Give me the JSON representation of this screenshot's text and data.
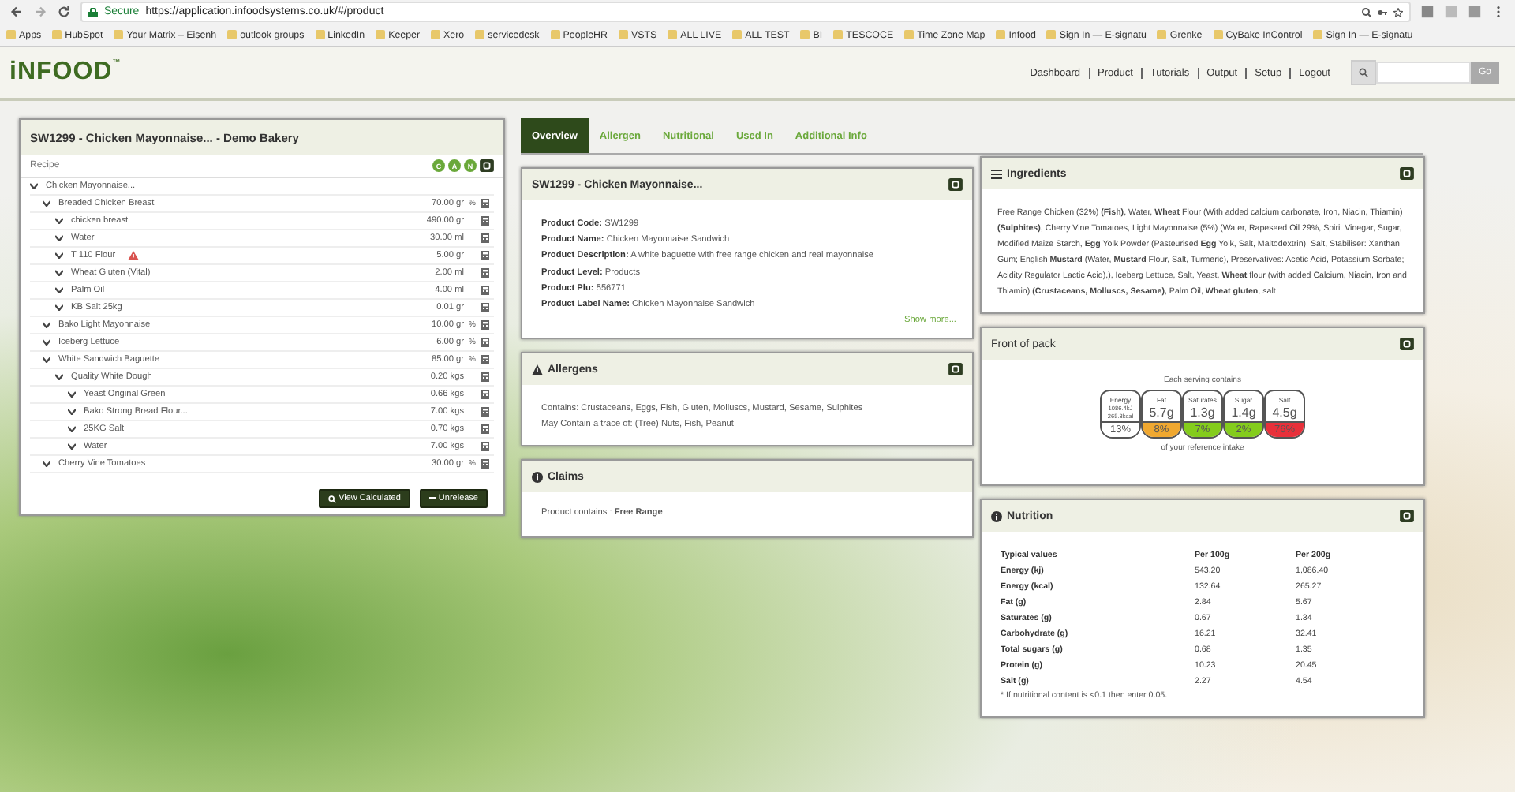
{
  "browser": {
    "secure_label": "Secure",
    "url": "https://application.infoodsystems.co.uk/#/product",
    "bookmarks": [
      "Apps",
      "HubSpot",
      "Your Matrix – Eisenh",
      "outlook groups",
      "LinkedIn",
      "Keeper",
      "Xero",
      "servicedesk",
      "PeopleHR",
      "VSTS",
      "ALL LIVE",
      "ALL TEST",
      "BI",
      "TESCOCE",
      "Time Zone Map",
      "Infood",
      "Sign In — E-signatu",
      "Grenke",
      "CyBake InControl",
      "Sign In — E-signatu"
    ]
  },
  "header": {
    "logo": "iNFOOD",
    "logo_mark": "™",
    "nav": [
      "Dashboard",
      "Product",
      "Tutorials",
      "Output",
      "Setup",
      "Logout"
    ],
    "search_button": "Go"
  },
  "recipe_panel": {
    "title": "SW1299  - Chicken Mayonnaise...  - Demo Bakery",
    "section": "Recipe",
    "badges": [
      "C",
      "A",
      "N"
    ],
    "tree": [
      {
        "name": "Chicken Mayonnaise...",
        "children": [
          {
            "name": "Breaded Chicken Breast",
            "amount": "70.00 gr",
            "percent": "%",
            "warning": false,
            "children": [
              {
                "name": "chicken breast",
                "amount": "490.00 gr",
                "warning": false
              },
              {
                "name": "Water",
                "amount": "30.00 ml",
                "warning": false
              },
              {
                "name": "T 110 Flour",
                "amount": "5.00 gr",
                "warning": true
              },
              {
                "name": "Wheat Gluten (Vital)",
                "amount": "2.00 ml",
                "warning": false
              },
              {
                "name": "Palm Oil",
                "amount": "4.00 ml",
                "warning": false
              },
              {
                "name": "KB Salt 25kg",
                "amount": "0.01 gr",
                "warning": false
              }
            ]
          },
          {
            "name": "Bako Light Mayonnaise",
            "amount": "10.00 gr",
            "percent": "%",
            "warning": false
          },
          {
            "name": "Iceberg Lettuce",
            "amount": "6.00 gr",
            "percent": "%",
            "warning": false
          },
          {
            "name": "White Sandwich Baguette",
            "amount": "85.00 gr",
            "percent": "%",
            "warning": false,
            "children": [
              {
                "name": "Quality White Dough",
                "amount": "0.20 kgs",
                "warning": false,
                "children": [
                  {
                    "name": "Yeast Original Green",
                    "amount": "0.66 kgs",
                    "warning": false
                  },
                  {
                    "name": "Bako Strong Bread Flour...",
                    "amount": "7.00 kgs",
                    "warning": false
                  },
                  {
                    "name": "25KG Salt",
                    "amount": "0.70 kgs",
                    "warning": false
                  },
                  {
                    "name": "Water",
                    "amount": "7.00 kgs",
                    "warning": false
                  }
                ]
              }
            ]
          },
          {
            "name": "Cherry Vine Tomatoes",
            "amount": "30.00 gr",
            "percent": "%",
            "warning": false
          }
        ]
      }
    ],
    "buttons": [
      "View Calculated",
      "Unrelease"
    ]
  },
  "tabs": [
    {
      "label": "Overview",
      "selected": true
    },
    {
      "label": "Allergen",
      "selected": false
    },
    {
      "label": "Nutritional",
      "selected": false
    },
    {
      "label": "Used In",
      "selected": false
    },
    {
      "label": "Additional Info",
      "selected": false
    }
  ],
  "product_card": {
    "title": "SW1299 - Chicken Mayonnaise...",
    "fields": [
      {
        "label": "Product Code:",
        "value": "SW1299"
      },
      {
        "label": "Product Name:",
        "value": "Chicken Mayonnaise Sandwich"
      },
      {
        "label": "Product Description:",
        "value": "A white baguette with free range chicken and real mayonnaise"
      },
      {
        "label": "Product Level:",
        "value": "Products"
      },
      {
        "label": "Product Plu:",
        "value": "556771"
      },
      {
        "label": "Product Label Name:",
        "value": "Chicken Mayonnaise Sandwich"
      }
    ],
    "link": "Show more..."
  },
  "allergens_card": {
    "title": "Allergens",
    "lines": [
      "Contains: Crustaceans, Eggs, Fish, Gluten, Molluscs, Mustard, Sesame, Sulphites",
      "May Contain a trace of: (Tree) Nuts, Fish, Peanut"
    ]
  },
  "claims_card": {
    "title": "Claims",
    "text": "Product contains : **Free Range**"
  },
  "ingredients_card": {
    "title": "Ingredients",
    "text": "Free Range Chicken (32%) **(Fish)**, Water, **Wheat** Flour (With added calcium carbonate, Iron, Niacin, Thiamin) **(Sulphites)**, Cherry Vine Tomatoes, Light Mayonnaise (5%) (Water, Rapeseed Oil 29%, Spirit Vinegar, Sugar, Modified Maize Starch, **Egg** Yolk Powder (Pasteurised **Egg** Yolk, Salt, Maltodextrin), Salt, Stabiliser: Xanthan Gum; English **Mustard** (Water, **Mustard** Flour, Salt, Turmeric), Preservatives: Acetic Acid, Potassium Sorbate; Acidity Regulator Lactic Acid),), Iceberg Lettuce, Salt, Yeast, **Wheat** flour (with added Calcium, Niacin, Iron and Thiamin) **(Crustaceans, Molluscs, Sesame)**, Palm Oil, **Wheat gluten**, salt"
  },
  "front_of_pack": {
    "title": "Front of pack",
    "heading": "Each serving contains",
    "footer": "of your reference intake",
    "items": [
      {
        "label": "Energy",
        "values": [
          "1086.4kJ",
          "265.3kcal"
        ],
        "percent": "13%",
        "color": "#ffffff"
      },
      {
        "label": "Fat",
        "values": [
          "5.7g"
        ],
        "percent": "8%",
        "color": "#f0a830"
      },
      {
        "label": "Saturates",
        "values": [
          "1.3g"
        ],
        "percent": "7%",
        "color": "#84cc1c"
      },
      {
        "label": "Sugar",
        "values": [
          "1.4g"
        ],
        "percent": "2%",
        "color": "#84cc1c"
      },
      {
        "label": "Salt",
        "values": [
          "4.5g"
        ],
        "percent": "76%",
        "color": "#e8303a"
      }
    ]
  },
  "nutrition_card": {
    "title": "Nutrition",
    "columns": [
      "Typical values",
      "Per 100g",
      "Per 200g"
    ],
    "rows": [
      [
        "Energy (kj)",
        "543.20",
        "1,086.40"
      ],
      [
        "Energy (kcal)",
        "132.64",
        "265.27"
      ],
      [
        "Fat (g)",
        "2.84",
        "5.67"
      ],
      [
        "Saturates (g)",
        "0.67",
        "1.34"
      ],
      [
        "Carbohydrate (g)",
        "16.21",
        "32.41"
      ],
      [
        "Total sugars (g)",
        "0.68",
        "1.35"
      ],
      [
        "Protein (g)",
        "10.23",
        "20.45"
      ],
      [
        "Salt (g)",
        "2.27",
        "4.54"
      ]
    ],
    "note": "* If nutritional content is <0.1 then enter 0.05."
  }
}
